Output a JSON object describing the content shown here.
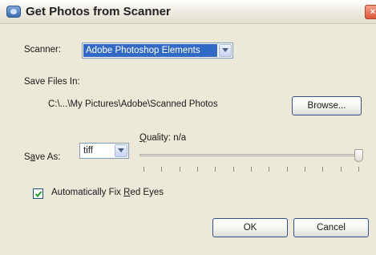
{
  "window": {
    "title": "Get Photos from Scanner",
    "close_glyph": "×"
  },
  "scanner": {
    "label": "Scanner:",
    "selected": "Adobe Photoshop Elements"
  },
  "save_files": {
    "label": "Save Files In:",
    "path": "C:\\...\\My Pictures\\Adobe\\Scanned Photos",
    "browse_label": "Browse..."
  },
  "save_as": {
    "label_prefix": "S",
    "label_accel": "a",
    "label_suffix": "ve As:",
    "selected": "tiff"
  },
  "quality": {
    "label_accel": "Q",
    "label_suffix": "uality: n/a",
    "level": 1.0,
    "tick_count": 13
  },
  "red_eye": {
    "checked": true,
    "label_prefix": "Automatically Fix ",
    "label_accel": "R",
    "label_suffix": "ed Eyes"
  },
  "buttons": {
    "ok": "OK",
    "cancel": "Cancel"
  },
  "colors": {
    "selection": "#316ac5",
    "dialog_bg": "#ece9d8",
    "button_border": "#34508e"
  }
}
